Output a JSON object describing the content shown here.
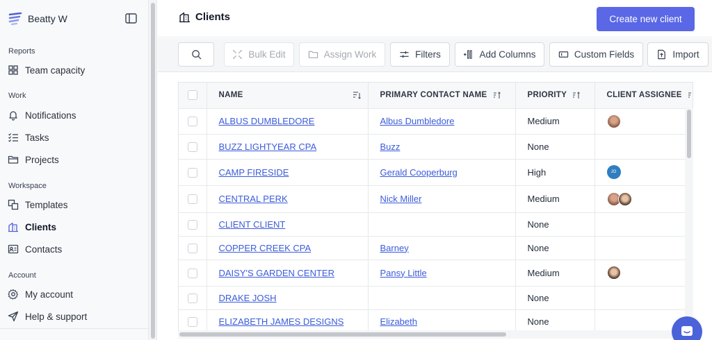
{
  "sidebar": {
    "workspace_name": "Beatty W",
    "sections": {
      "reports": "Reports",
      "work": "Work",
      "workspace": "Workspace",
      "account": "Account"
    },
    "items": {
      "team_capacity": "Team capacity",
      "notifications": "Notifications",
      "tasks": "Tasks",
      "projects": "Projects",
      "templates": "Templates",
      "clients": "Clients",
      "contacts": "Contacts",
      "my_account": "My account",
      "help_support": "Help & support"
    }
  },
  "header": {
    "title": "Clients",
    "create_label": "Create new client"
  },
  "toolbar": {
    "bulk_edit": "Bulk Edit",
    "assign_work": "Assign Work",
    "filters": "Filters",
    "add_columns": "Add Columns",
    "custom_fields": "Custom Fields",
    "import": "Import"
  },
  "table": {
    "headers": {
      "name": "NAME",
      "primary_contact": "PRIMARY CONTACT NAME",
      "priority": "PRIORITY",
      "assignee": "CLIENT ASSIGNEE"
    },
    "rows": [
      {
        "name": "ALBUS DUMBLEDORE",
        "contact": "Albus Dumbledore",
        "priority": "Medium"
      },
      {
        "name": "BUZZ LIGHTYEAR CPA",
        "contact": "Buzz",
        "priority": "None"
      },
      {
        "name": "CAMP FIRESIDE",
        "contact": "Gerald Cooperburg",
        "priority": "High",
        "initials": "JO"
      },
      {
        "name": "CENTRAL PERK",
        "contact": "Nick Miller",
        "priority": "Medium"
      },
      {
        "name": "CLIENT CLIENT",
        "contact": "",
        "priority": "None"
      },
      {
        "name": "COPPER CREEK CPA",
        "contact": "Barney",
        "priority": "None"
      },
      {
        "name": "DAISY'S GARDEN CENTER",
        "contact": "Pansy Little",
        "priority": "Medium"
      },
      {
        "name": "DRAKE JOSH",
        "contact": "",
        "priority": "None"
      },
      {
        "name": "ELIZABETH JAMES DESIGNS",
        "contact": "Elizabeth",
        "priority": "None"
      }
    ]
  },
  "colors": {
    "primary": "#5a67e6",
    "link": "#3b5bdb",
    "sidebar_bg": "#f8f9fb"
  }
}
